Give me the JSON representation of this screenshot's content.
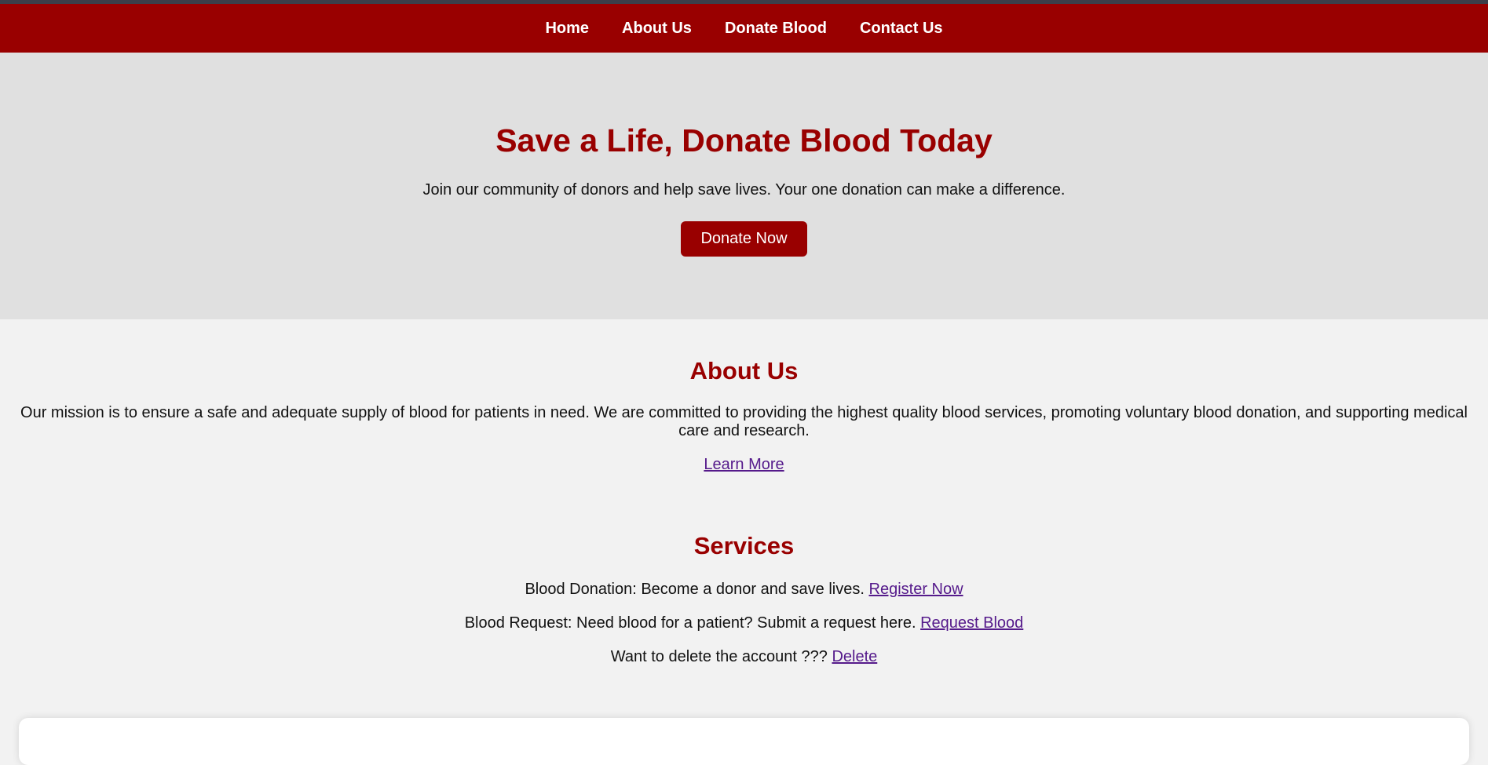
{
  "nav": {
    "items": [
      {
        "label": "Home"
      },
      {
        "label": "About Us"
      },
      {
        "label": "Donate Blood"
      },
      {
        "label": "Contact Us"
      }
    ]
  },
  "hero": {
    "title": "Save a Life, Donate Blood Today",
    "subtitle": "Join our community of donors and help save lives. Your one donation can make a difference.",
    "button_label": "Donate Now"
  },
  "about": {
    "heading": "About Us",
    "mission": "Our mission is to ensure a safe and adequate supply of blood for patients in need. We are committed to providing the highest quality blood services, promoting voluntary blood donation, and supporting medical care and research.",
    "link_label": "Learn More"
  },
  "services": {
    "heading": "Services",
    "items": [
      {
        "text": "Blood Donation: Become a donor and save lives.",
        "link_label": "Register Now"
      },
      {
        "text": "Blood Request: Need blood for a patient? Submit a request here.",
        "link_label": "Request Blood"
      },
      {
        "text": "Want to delete the account ???",
        "link_label": "Delete"
      }
    ]
  },
  "colors": {
    "brand_red": "#990000",
    "hero_bg": "#e0e0e0",
    "page_bg": "#f2f2f2",
    "link": "#551a8b"
  }
}
